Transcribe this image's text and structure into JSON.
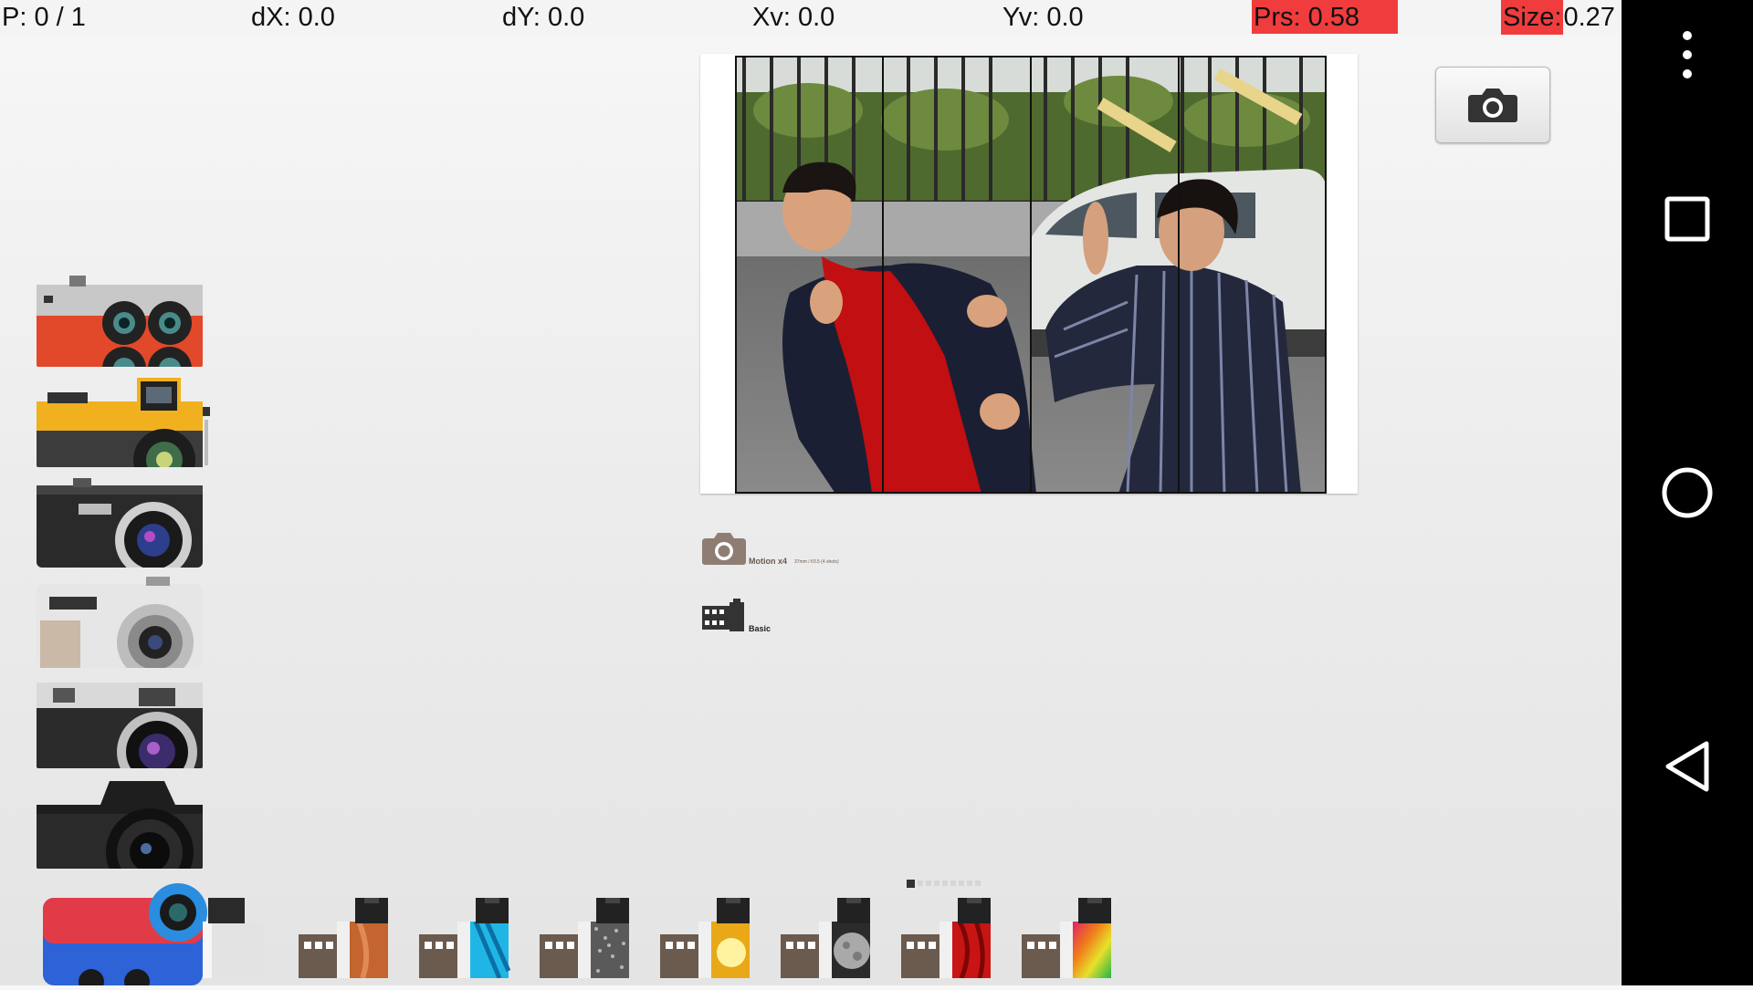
{
  "debug": {
    "pointer": "P: 0 / 1",
    "dx": "dX: 0.0",
    "dy": "dY: 0.0",
    "xv": "Xv: 0.0",
    "yv": "Yv: 0.0",
    "prs": "Prs: 0.58",
    "size_label": "Size:",
    "size_value": "0.27",
    "highlight_color": "#f03c3c"
  },
  "navbar": {
    "buttons": [
      "overflow-menu",
      "recents",
      "home",
      "back"
    ]
  },
  "cameras": [
    {
      "name": "camera-quad-lens-red"
    },
    {
      "name": "camera-yellow-toy"
    },
    {
      "name": "camera-black-compact"
    },
    {
      "name": "camera-silver-compact"
    },
    {
      "name": "camera-rangefinder"
    },
    {
      "name": "camera-dslr"
    },
    {
      "name": "camera-blue-red-toy"
    }
  ],
  "preview": {
    "strips": 4
  },
  "shutter_button": {
    "icon": "camera-icon"
  },
  "info": {
    "camera_name": "Motion x4",
    "camera_detail": "37mm / f/3.5 (4 shots)",
    "film_name": "Basic"
  },
  "pager": {
    "current": 1,
    "total": 9
  },
  "films": [
    {
      "name": "film-basic",
      "color": "#d9d9d9"
    },
    {
      "name": "film-copper",
      "color": "#c4642e"
    },
    {
      "name": "film-aqua",
      "color": "#1fb6e6"
    },
    {
      "name": "film-grain",
      "color": "#8a8a8a"
    },
    {
      "name": "film-golden",
      "color": "#f2c230"
    },
    {
      "name": "film-moon",
      "color": "#a9a9a9"
    },
    {
      "name": "film-red",
      "color": "#c81414"
    },
    {
      "name": "film-rainbow",
      "color": "#e85a2c"
    }
  ]
}
